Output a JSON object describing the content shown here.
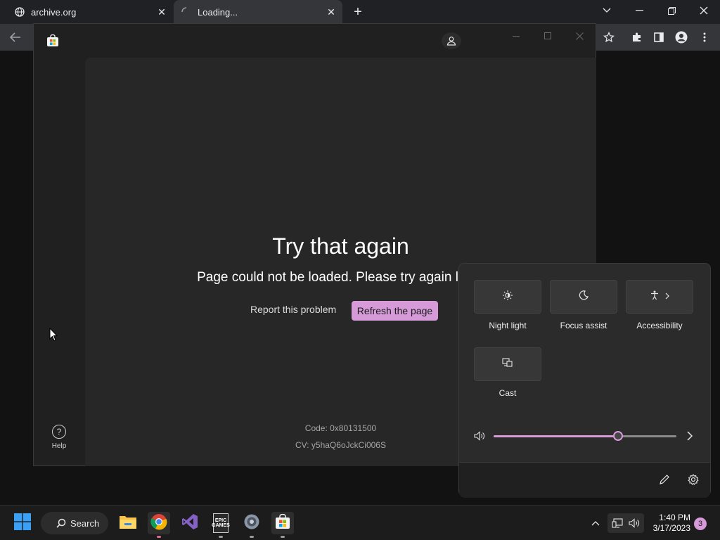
{
  "browser": {
    "tabs": [
      {
        "title": "archive.org"
      },
      {
        "title": "Loading..."
      }
    ],
    "new_tab_symbol": "+"
  },
  "store": {
    "error_title": "Try that again",
    "error_message": "Page could not be loaded. Please try again later.",
    "report_link": "Report this problem",
    "refresh_button": "Refresh the page",
    "code": "Code: 0x80131500",
    "cv": "CV: y5haQ6oJckCi006S",
    "help_label": "Help"
  },
  "quick_settings": {
    "tiles": [
      {
        "label": "Night light",
        "icon": "brightness-icon"
      },
      {
        "label": "Focus assist",
        "icon": "moon-icon"
      },
      {
        "label": "Accessibility",
        "icon": "accessibility-icon"
      },
      {
        "label": "Cast",
        "icon": "cast-icon"
      }
    ],
    "volume_level": 0.68,
    "accent_color": "#d69ad9"
  },
  "taskbar": {
    "search_label": "Search",
    "time": "1:40 PM",
    "date": "3/17/2023",
    "notification_count": "3",
    "epic_label": "EPIC GAMES"
  }
}
